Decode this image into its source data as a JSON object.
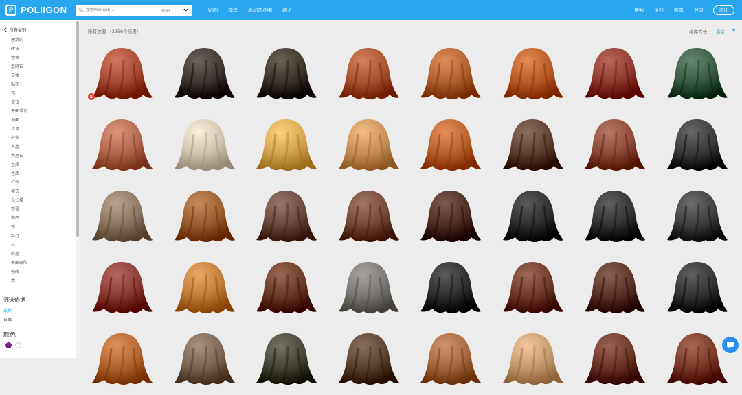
{
  "header": {
    "logo_mark": "P",
    "logo_text": "POLIIGON",
    "search_placeholder": "搜索Poliigon ...",
    "search_category": "贴图",
    "nav": [
      "贴图",
      "模模",
      "高动态范围",
      "刷子"
    ],
    "right_nav": [
      "博客",
      "价钱",
      "教本",
      "登录"
    ],
    "register": "注册"
  },
  "sidebar": {
    "back_label": "所有类别",
    "categories": [
      "建筑的",
      "砖块",
      "性格",
      "混碎石",
      "自体",
      "贴花",
      "布",
      "餐饮",
      "平面设计",
      "地面",
      "垃圾",
      "产业",
      "人造",
      "大理石",
      "金属",
      "性质",
      "打包",
      "模式",
      "光扫描",
      "石膏",
      "岩石",
      "锈",
      "料灯",
      "石",
      "街道",
      "表面缺陷",
      "瓷砖",
      "木"
    ],
    "filter_title": "筛选依据",
    "filters": [
      "最新",
      "自由"
    ],
    "color_title": "颜色"
  },
  "main": {
    "result_text": "所有纹理 （3256个结果）",
    "sort_label": "排序方式:",
    "sort_value": "最新",
    "badge_text": "S"
  },
  "colors": {
    "accent": "#2aa6ef",
    "swatch_purple": "#7d1d86",
    "tiles": [
      [
        "#a64a32",
        "#3f3631",
        "#3d342a",
        "#a7532f",
        "#b0612e",
        "#b85c26",
        "#8e3a2e",
        "#3b5a44"
      ],
      [
        "#b0674d",
        "#cfc3b0",
        "#d4a450",
        "#c78f58",
        "#b9612c",
        "#5e4133",
        "#8c4a38",
        "#3a3a3a"
      ],
      [
        "#8b7563",
        "#9a5d2d",
        "#6a4a3e",
        "#73493a",
        "#4e2e22",
        "#2e2e2e",
        "#333333",
        "#3f3f3f"
      ],
      [
        "#8a3a34",
        "#c07a3a",
        "#6b3a25",
        "#7a7672",
        "#2f2e2c",
        "#6f3a2a",
        "#5a3428",
        "#333333"
      ],
      [
        "#b0652e",
        "#7a6454",
        "#464538",
        "#5b4333",
        "#a2673e",
        "#c49a6e",
        "#6b3628",
        "#7a3a26"
      ]
    ]
  }
}
